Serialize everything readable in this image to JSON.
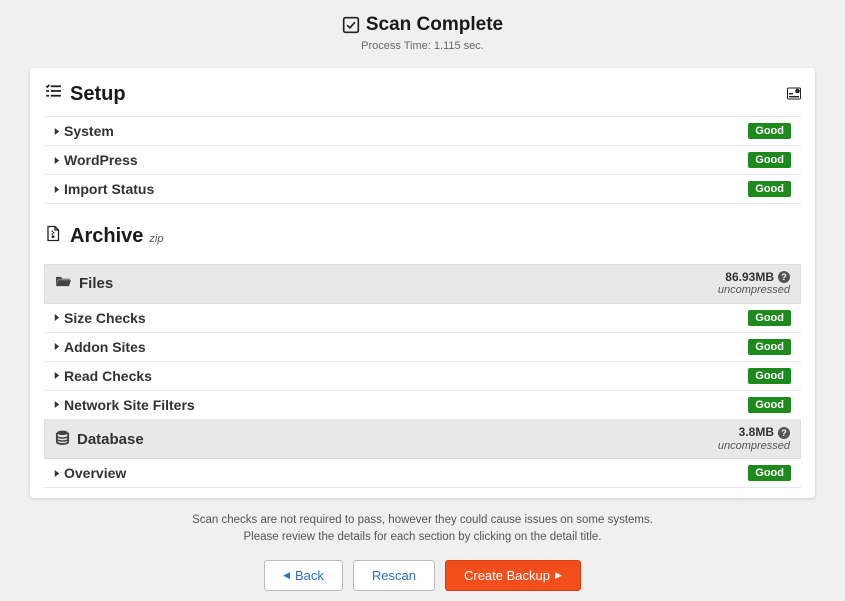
{
  "header": {
    "title": "Scan Complete",
    "process_time_label": "Process Time: 1.115 sec."
  },
  "sections": {
    "setup": {
      "title": "Setup",
      "items": [
        {
          "label": "System",
          "status": "Good"
        },
        {
          "label": "WordPress",
          "status": "Good"
        },
        {
          "label": "Import Status",
          "status": "Good"
        }
      ]
    },
    "archive": {
      "title": "Archive",
      "format": "zip",
      "groups": [
        {
          "title": "Files",
          "size": "86.93MB",
          "state": "uncompressed",
          "items": [
            {
              "label": "Size Checks",
              "status": "Good"
            },
            {
              "label": "Addon Sites",
              "status": "Good"
            },
            {
              "label": "Read Checks",
              "status": "Good"
            },
            {
              "label": "Network Site Filters",
              "status": "Good"
            }
          ]
        },
        {
          "title": "Database",
          "size": "3.8MB",
          "state": "uncompressed",
          "items": [
            {
              "label": "Overview",
              "status": "Good"
            }
          ]
        }
      ]
    }
  },
  "footer": {
    "note_line1": "Scan checks are not required to pass, however they could cause issues on some systems.",
    "note_line2": "Please review the details for each section by clicking on the detail title.",
    "buttons": {
      "back": "Back",
      "rescan": "Rescan",
      "create": "Create Backup"
    }
  },
  "icons": {
    "check_label": "scan-complete-check-icon",
    "help_label": "?"
  }
}
